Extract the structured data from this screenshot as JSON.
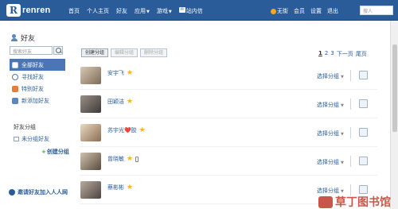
{
  "header": {
    "logo_text": "renren",
    "nav": [
      "首页",
      "个人主页",
      "好友",
      "应用",
      "游戏",
      "站内信"
    ],
    "nav_dropdown_marks": [
      "▼",
      "▼"
    ],
    "right_links": [
      "无街",
      "会员",
      "设置",
      "退出"
    ],
    "search_placeholder": "搜人"
  },
  "sidebar": {
    "title": "好友",
    "search_placeholder": "搜索好友",
    "items": [
      {
        "label": "全部好友",
        "icon": "all-friends-icon",
        "active": true
      },
      {
        "label": "寻找好友",
        "icon": "search-icon",
        "active": false
      },
      {
        "label": "特别好友",
        "icon": "special-friends-icon",
        "active": false
      },
      {
        "label": "新添加好友",
        "icon": "new-friends-icon",
        "active": false
      }
    ],
    "group_title": "好友分组",
    "ungrouped": "未分组好友",
    "create_group": "创建分组",
    "invite": "邀请好友加入人人网"
  },
  "toolbar": {
    "create_group": "创建分组",
    "edit_group": "编辑分组",
    "delete_group": "删除分组"
  },
  "pager": {
    "pages": [
      "1",
      "2",
      "3"
    ],
    "current": "1",
    "next": "下一页",
    "last": "尾页"
  },
  "friends": [
    {
      "name": "安宇飞",
      "starred": true,
      "phone": false,
      "group_label": "选择分组"
    },
    {
      "name": "田颖洁",
      "starred": true,
      "phone": false,
      "group_label": "选择分组"
    },
    {
      "name": "苏宇光❤️胶",
      "starred": true,
      "phone": false,
      "group_label": "选择分组"
    },
    {
      "name": "曾晓敏",
      "starred": true,
      "phone": true,
      "group_label": "选择分组"
    },
    {
      "name": "蔡彬彬",
      "starred": true,
      "phone": false,
      "group_label": "选择分组"
    }
  ],
  "watermark": "草丁图书馆",
  "colors": {
    "brand": "#2a5c9a",
    "star": "#f0b323",
    "active": "#4a76b6"
  }
}
